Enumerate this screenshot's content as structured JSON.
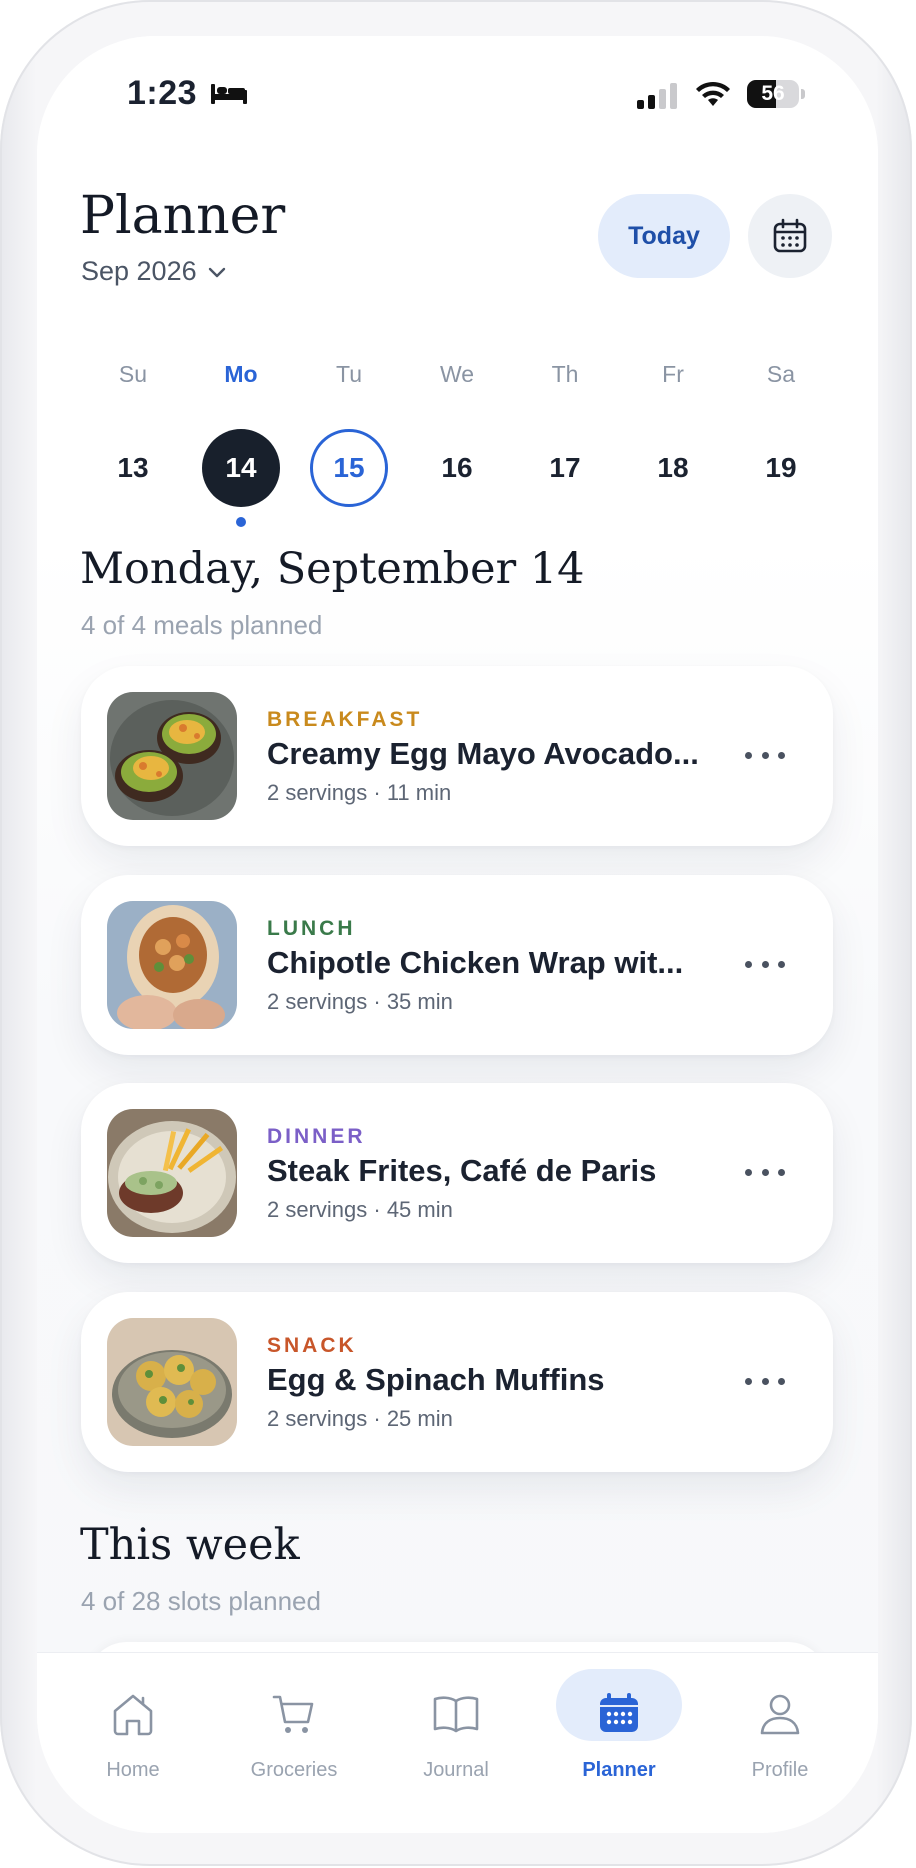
{
  "status_bar": {
    "time": "1:23",
    "battery": "56"
  },
  "header": {
    "title": "Planner",
    "month": "Sep 2026",
    "today_button": "Today"
  },
  "week": {
    "days": [
      {
        "name": "Su",
        "num": "13"
      },
      {
        "name": "Mo",
        "num": "14"
      },
      {
        "name": "Tu",
        "num": "15"
      },
      {
        "name": "We",
        "num": "16"
      },
      {
        "name": "Th",
        "num": "17"
      },
      {
        "name": "Fr",
        "num": "18"
      },
      {
        "name": "Sa",
        "num": "19"
      }
    ],
    "selected_index": 1,
    "today_index": 2
  },
  "day_section": {
    "title": "Monday, September 14",
    "subtitle": "4 of 4 meals planned"
  },
  "meals": [
    {
      "type": "BREAKFAST",
      "type_color": "#c98a1d",
      "name": "Creamy Egg Mayo Avocado...",
      "meta": "2 servings · 11 min"
    },
    {
      "type": "LUNCH",
      "type_color": "#3a7a4a",
      "name": "Chipotle Chicken Wrap wit...",
      "meta": "2 servings · 35 min"
    },
    {
      "type": "DINNER",
      "type_color": "#7b5fc7",
      "name": "Steak Frites, Café de Paris",
      "meta": "2 servings · 45 min"
    },
    {
      "type": "SNACK",
      "type_color": "#c8562a",
      "name": "Egg & Spinach Muffins",
      "meta": "2 servings · 25 min"
    }
  ],
  "week_section": {
    "title": "This week",
    "subtitle": "4 of 28 slots planned"
  },
  "tabs": [
    {
      "label": "Home",
      "icon": "home-icon"
    },
    {
      "label": "Groceries",
      "icon": "cart-icon"
    },
    {
      "label": "Journal",
      "icon": "book-icon"
    },
    {
      "label": "Planner",
      "icon": "calendar-icon"
    },
    {
      "label": "Profile",
      "icon": "person-icon"
    }
  ],
  "colors": {
    "accent": "#2a64d6",
    "selected_day": "#18202c",
    "today_pill": "#e3ecfb"
  }
}
